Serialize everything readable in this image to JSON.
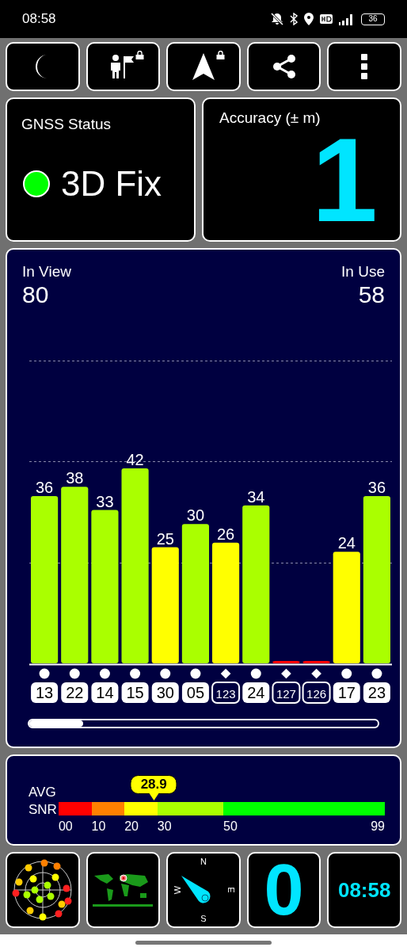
{
  "status_bar": {
    "time": "08:58",
    "battery": "36"
  },
  "toolbar": [
    {
      "kind": "moon",
      "locked": false
    },
    {
      "kind": "person-flag",
      "locked": true
    },
    {
      "kind": "navigation",
      "locked": true
    },
    {
      "kind": "share",
      "locked": false
    },
    {
      "kind": "more",
      "locked": false
    }
  ],
  "gnss_status": {
    "title": "GNSS Status",
    "value": "3D Fix",
    "color": "#00ff00"
  },
  "accuracy": {
    "title": "Accuracy (± m)",
    "value": "1"
  },
  "satellites": {
    "in_view_label": "In View",
    "in_view": "80",
    "in_use_label": "In Use",
    "in_use": "58",
    "chart_data": {
      "type": "bar",
      "categories": [
        "13",
        "22",
        "14",
        "15",
        "30",
        "05",
        "123",
        "24",
        "127",
        "126",
        "17",
        "23"
      ],
      "values": [
        36,
        38,
        33,
        42,
        25,
        30,
        26,
        34,
        0,
        0,
        24,
        36
      ],
      "value_labels": [
        "36",
        "38",
        "33",
        "42",
        "25",
        "30",
        "26",
        "34",
        null,
        null,
        "24",
        "36"
      ]
    },
    "marks": [
      {
        "kind": "circle",
        "used": true
      },
      {
        "kind": "circle",
        "used": true
      },
      {
        "kind": "circle",
        "used": true
      },
      {
        "kind": "circle",
        "used": true
      },
      {
        "kind": "circle",
        "used": true
      },
      {
        "kind": "circle",
        "used": true
      },
      {
        "kind": "diamond",
        "used": false
      },
      {
        "kind": "circle",
        "used": true
      },
      {
        "kind": "diamond",
        "used": false
      },
      {
        "kind": "diamond",
        "used": false
      },
      {
        "kind": "circle",
        "used": true
      },
      {
        "kind": "circle",
        "used": true
      }
    ]
  },
  "snr": {
    "label_1": "AVG",
    "label_2": "SNR",
    "value": "28.9",
    "ticks": [
      "00",
      "10",
      "20",
      "30",
      "50",
      "99"
    ]
  },
  "bottom_tiles": {
    "compass": [
      "N",
      "E",
      "S",
      "W"
    ],
    "count": "0",
    "clock": "08:58"
  }
}
